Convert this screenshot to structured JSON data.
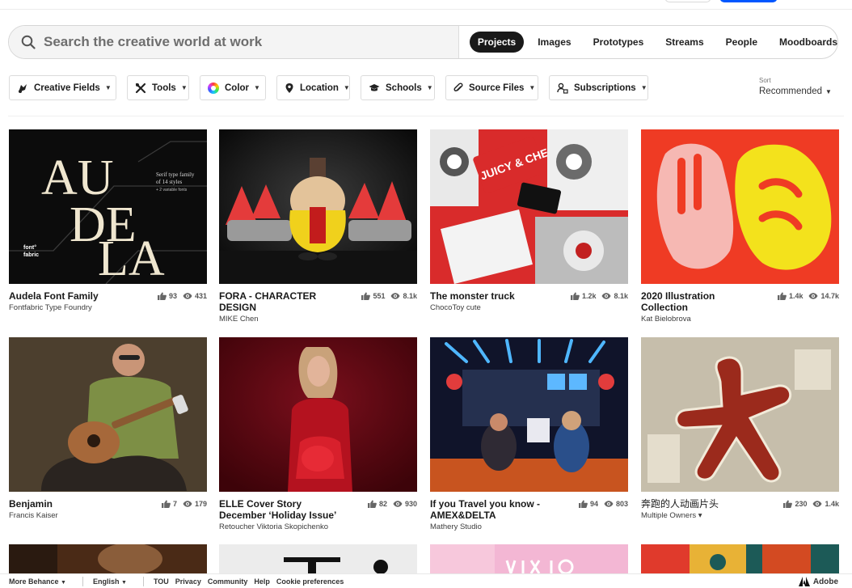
{
  "search": {
    "placeholder": "Search the creative world at work",
    "tabs": [
      {
        "label": "Projects",
        "active": true
      },
      {
        "label": "Images"
      },
      {
        "label": "Prototypes"
      },
      {
        "label": "Streams"
      },
      {
        "label": "People"
      },
      {
        "label": "Moodboards"
      }
    ]
  },
  "filters": {
    "creative_fields": "Creative Fields",
    "tools": "Tools",
    "color": "Color",
    "location": "Location",
    "schools": "Schools",
    "source_files": "Source Files",
    "subscriptions": "Subscriptions"
  },
  "sort": {
    "label": "Sort",
    "value": "Recommended"
  },
  "projects": [
    {
      "title": "Audela Font Family",
      "owner": "Fontfabric Type Foundry",
      "likes": "93",
      "views": "431",
      "thumb_text": {
        "brand": "font° fabric",
        "tagline": "Serif type family of 14 styles",
        "sub": "+ 2 variable fonts"
      }
    },
    {
      "title": "FORA - CHARACTER DESIGN",
      "owner": "MIKE Chen",
      "likes": "551",
      "views": "8.1k"
    },
    {
      "title": "The monster truck",
      "owner": "ChocoToy cute",
      "likes": "1.2k",
      "views": "8.1k",
      "thumb_text": {
        "badge": "JUICY & CHEESY"
      }
    },
    {
      "title": "2020 Illustration Collection",
      "owner": "Kat Bielobrova",
      "likes": "1.4k",
      "views": "14.7k"
    },
    {
      "title": "Benjamin",
      "owner": "Francis Kaiser",
      "likes": "7",
      "views": "179"
    },
    {
      "title": "ELLE Cover Story December ‘Holiday Issue’",
      "owner": "Retoucher Viktoria Skopichenko",
      "likes": "82",
      "views": "930"
    },
    {
      "title": "If you Travel you know - AMEX&DELTA",
      "owner": "Mathery Studio",
      "likes": "94",
      "views": "803"
    },
    {
      "title": "奔跑的人动画片头",
      "owner": "Multiple Owners ▾",
      "likes": "230",
      "views": "1.4k"
    }
  ],
  "footer": {
    "more_behance": "More Behance",
    "language": "English",
    "links": [
      "TOU",
      "Privacy",
      "Community",
      "Help",
      "Cookie preferences"
    ],
    "adobe": "Adobe"
  },
  "colors": {
    "accent": "#0057ff",
    "active_tab": "#191919"
  }
}
